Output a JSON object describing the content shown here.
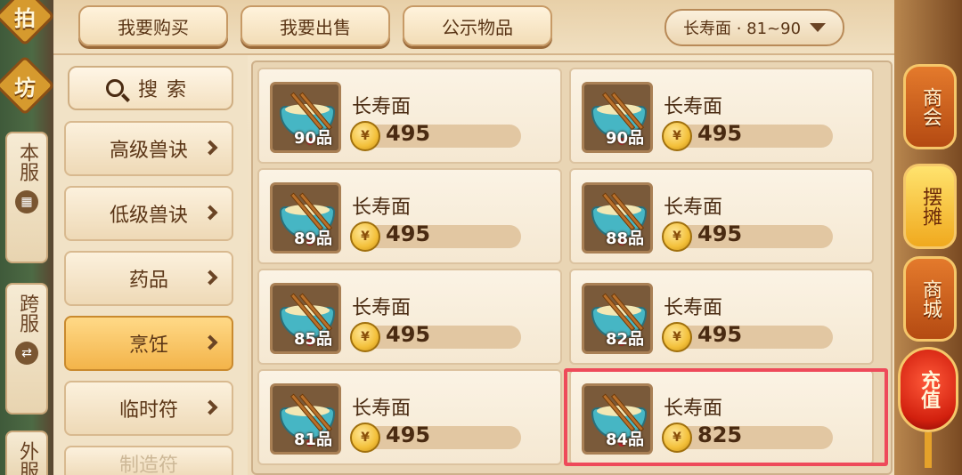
{
  "left_tabs": {
    "deco_top": "拍",
    "deco_mid": "坊",
    "tab1": "本服",
    "tab2": "跨服",
    "tab3": "外服"
  },
  "top": {
    "buy": "我要购买",
    "sell": "我要出售",
    "public": "公示物品",
    "level_filter": "长寿面 · 81~90"
  },
  "search": {
    "label": "搜索"
  },
  "categories": [
    {
      "label": "高级兽诀",
      "active": false
    },
    {
      "label": "低级兽诀",
      "active": false
    },
    {
      "label": "药品",
      "active": false
    },
    {
      "label": "烹饪",
      "active": true
    },
    {
      "label": "临时符",
      "active": false
    },
    {
      "label": "制造符",
      "active": false
    }
  ],
  "items": [
    {
      "name": "长寿面",
      "grade": "90品",
      "price": "495"
    },
    {
      "name": "长寿面",
      "grade": "90品",
      "price": "495"
    },
    {
      "name": "长寿面",
      "grade": "89品",
      "price": "495"
    },
    {
      "name": "长寿面",
      "grade": "88品",
      "price": "495"
    },
    {
      "name": "长寿面",
      "grade": "85品",
      "price": "495"
    },
    {
      "name": "长寿面",
      "grade": "82品",
      "price": "495"
    },
    {
      "name": "长寿面",
      "grade": "81品",
      "price": "495"
    },
    {
      "name": "长寿面",
      "grade": "84品",
      "price": "825"
    }
  ],
  "right_tabs": {
    "guild": "商会",
    "stall": "摆摊",
    "mall": "商城",
    "recharge": "充值"
  },
  "colors": {
    "highlight": "#ee4a5a",
    "active_category": "#f3b44a"
  }
}
